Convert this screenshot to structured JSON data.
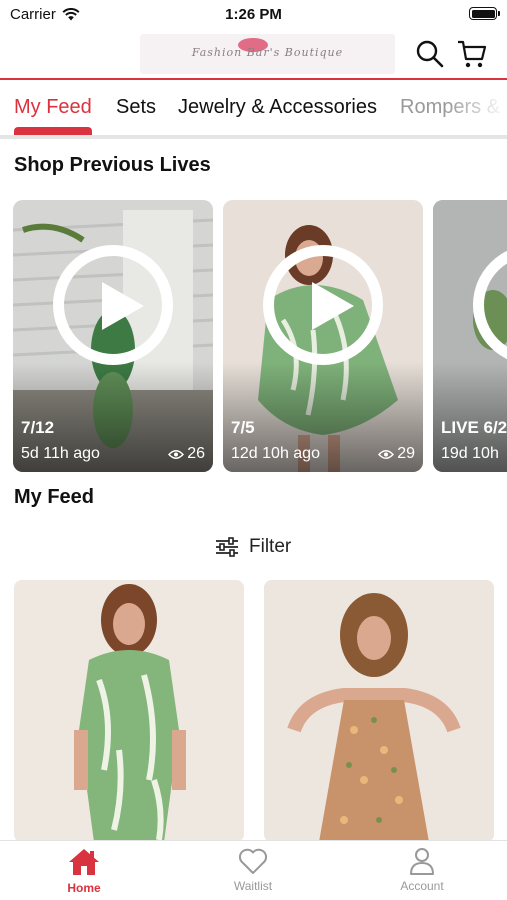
{
  "status_bar": {
    "carrier": "Carrier",
    "time": "1:26 PM"
  },
  "header": {
    "logo_text": "Fashion Bar's Boutique"
  },
  "tabs": [
    {
      "label": "My Feed",
      "active": true
    },
    {
      "label": "Sets",
      "active": false
    },
    {
      "label": "Jewelry & Accessories",
      "active": false
    },
    {
      "label": "Rompers &",
      "active": false
    }
  ],
  "lives": {
    "title": "Shop Previous Lives",
    "items": [
      {
        "date": "7/12",
        "ago": "5d 11h ago",
        "views": "26"
      },
      {
        "date": "7/5",
        "ago": "12d 10h ago",
        "views": "29"
      },
      {
        "date": "LIVE 6/2",
        "ago": "19d 10h",
        "views": ""
      }
    ]
  },
  "feed": {
    "title": "My Feed",
    "filter_label": "Filter"
  },
  "bottom_nav": {
    "home": "Home",
    "waitlist": "Waitlist",
    "account": "Account"
  },
  "colors": {
    "accent": "#d9333f",
    "inactive": "#999999"
  }
}
